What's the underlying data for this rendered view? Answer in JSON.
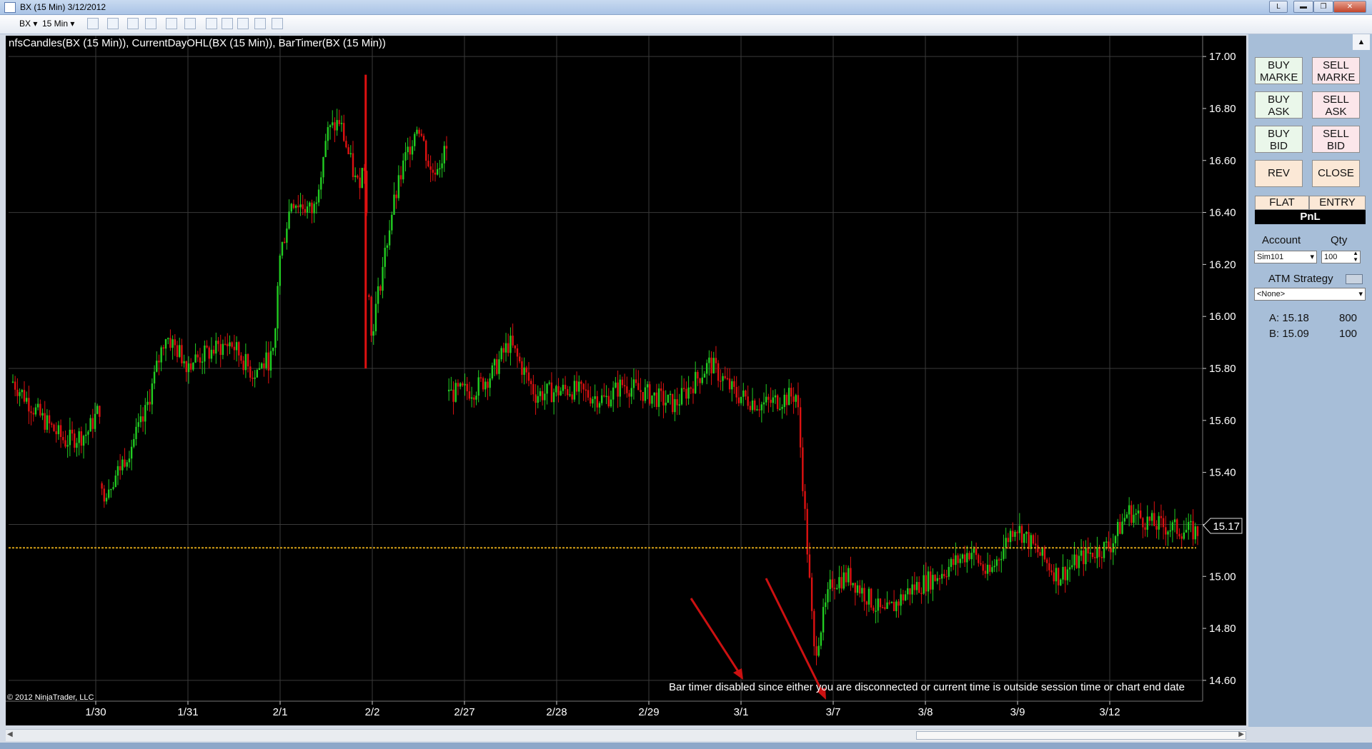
{
  "window": {
    "title": "BX (15 Min)  3/12/2012",
    "l_button": "L"
  },
  "toolbar": {
    "instrument": "BX",
    "interval": "15 Min"
  },
  "chart_data": {
    "type": "candlestick",
    "title": "nfsCandles(BX (15 Min)), CurrentDayOHL(BX (15 Min)), BarTimer(BX (15 Min))",
    "categories": [
      "1/30",
      "1/31",
      "2/1",
      "2/2",
      "2/27",
      "2/28",
      "2/29",
      "3/1",
      "3/7",
      "3/8",
      "3/9",
      "3/12"
    ],
    "ylim": [
      14.52,
      17.08
    ],
    "yticks": [
      "17.00",
      "16.80",
      "16.60",
      "16.40",
      "16.20",
      "16.00",
      "15.80",
      "15.60",
      "15.40",
      "15.20",
      "15.00",
      "14.80",
      "14.60"
    ],
    "price_path": [
      [
        0,
        15.75
      ],
      [
        0.3,
        15.62
      ],
      [
        0.6,
        15.52
      ],
      [
        0.85,
        15.55
      ],
      [
        1,
        15.65
      ],
      [
        1,
        15.3
      ],
      [
        1.2,
        15.4
      ],
      [
        1.5,
        15.6
      ],
      [
        1.75,
        15.93
      ],
      [
        2,
        15.82
      ],
      [
        2.5,
        15.9
      ],
      [
        2.75,
        15.78
      ],
      [
        3,
        15.85
      ],
      [
        3.05,
        16.2
      ],
      [
        3.2,
        16.45
      ],
      [
        3.45,
        16.4
      ],
      [
        3.6,
        16.7
      ],
      [
        3.75,
        16.75
      ],
      [
        3.95,
        16.5
      ],
      [
        4.05,
        16.6
      ],
      [
        4.1,
        15.9
      ],
      [
        4.2,
        16.1
      ],
      [
        4.35,
        16.4
      ],
      [
        4.5,
        16.6
      ],
      [
        4.65,
        16.75
      ],
      [
        4.8,
        16.55
      ],
      [
        5,
        16.65
      ],
      [
        5,
        15.7
      ],
      [
        5.3,
        15.72
      ],
      [
        5.5,
        15.78
      ],
      [
        5.7,
        15.9
      ],
      [
        6,
        15.7
      ],
      [
        6.4,
        15.72
      ],
      [
        6.8,
        15.68
      ],
      [
        7,
        15.74
      ],
      [
        7.3,
        15.7
      ],
      [
        7.6,
        15.66
      ],
      [
        8,
        15.82
      ],
      [
        8.3,
        15.7
      ],
      [
        8.6,
        15.66
      ],
      [
        9,
        15.7
      ],
      [
        9.2,
        14.7
      ],
      [
        9.4,
        14.98
      ],
      [
        9.6,
        15.0
      ],
      [
        10,
        14.85
      ],
      [
        10.3,
        14.95
      ],
      [
        10.6,
        15.0
      ],
      [
        11,
        15.1
      ],
      [
        11.2,
        15.0
      ],
      [
        11.5,
        15.2
      ],
      [
        11.8,
        15.08
      ],
      [
        12,
        15.0
      ],
      [
        12.3,
        15.08
      ],
      [
        12.6,
        15.12
      ],
      [
        12.8,
        15.25
      ],
      [
        13.1,
        15.2
      ],
      [
        13.4,
        15.18
      ],
      [
        13.6,
        15.17
      ]
    ],
    "current_price": "15.17",
    "prior_close_line": 15.11,
    "bar_timer_message": "Bar timer disabled since either you are disconnected or current time is outside session time or chart end date",
    "copyright": "© 2012 NinjaTrader, LLC",
    "colors": {
      "background": "#000000",
      "up": "#22cc22",
      "down": "#dd1111",
      "close_line": "#d4a017",
      "grid": "#3a3a3a",
      "arrow": "#cc1111"
    }
  },
  "sidebar": {
    "buy_market": "BUY MARKE",
    "sell_market": "SELL MARKE",
    "buy_ask": "BUY ASK",
    "sell_ask": "SELL ASK",
    "buy_bid": "BUY BID",
    "sell_bid": "SELL BID",
    "rev": "REV",
    "close": "CLOSE",
    "flat": "FLAT",
    "entry": "ENTRY",
    "pnl": "PnL",
    "account_label": "Account",
    "qty_label": "Qty",
    "account_value": "Sim101",
    "qty_value": "100",
    "atm_label": "ATM Strategy",
    "atm_value": "<None>",
    "ask_label": "A: 15.18",
    "ask_size": "800",
    "bid_label": "B: 15.09",
    "bid_size": "100"
  }
}
